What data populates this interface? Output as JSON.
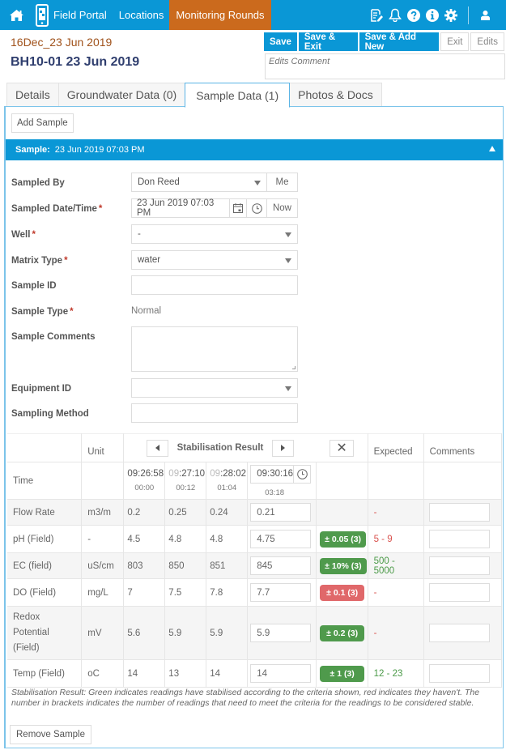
{
  "navbar": {
    "brand_label": "Field Portal",
    "links": [
      {
        "label": "Locations",
        "active": false
      },
      {
        "label": "Monitoring Rounds",
        "active": true
      }
    ],
    "right_icons": [
      "edit-notes-icon",
      "bell-icon",
      "help-icon",
      "info-icon",
      "gear-icon",
      "user-icon"
    ],
    "colors": {
      "bar": "#0a97d6",
      "active": "#cb6a1d"
    }
  },
  "header": {
    "round_title": "16Dec_23 Jun 2019",
    "record_title": "BH10-01 23 Jun 2019",
    "buttons": {
      "save": "Save",
      "save_exit": "Save & Exit",
      "save_add_new": "Save & Add New",
      "exit": "Exit",
      "edits": "Edits"
    },
    "edits_comment_placeholder": "Edits Comment"
  },
  "tabs": [
    {
      "label": "Details",
      "active": false
    },
    {
      "label": "Groundwater Data (0)",
      "active": false
    },
    {
      "label": "Sample Data (1)",
      "active": true
    },
    {
      "label": "Photos & Docs",
      "active": false
    }
  ],
  "sample_panel": {
    "add_sample_label": "Add Sample",
    "header_label": "Sample:",
    "header_value": "23 Jun 2019 07:03 PM",
    "form": {
      "sampled_by": {
        "label": "Sampled By",
        "value": "Don Reed",
        "me_label": "Me"
      },
      "sampled_datetime": {
        "label": "Sampled Date/Time",
        "required": "*",
        "value": "23 Jun 2019 07:03 PM",
        "now_label": "Now"
      },
      "well": {
        "label": "Well",
        "required": "*",
        "value": "-"
      },
      "matrix_type": {
        "label": "Matrix Type",
        "required": "*",
        "value": "water"
      },
      "sample_id": {
        "label": "Sample ID",
        "value": ""
      },
      "sample_type": {
        "label": "Sample Type",
        "required": "*",
        "value": "Normal"
      },
      "sample_comments": {
        "label": "Sample Comments",
        "value": ""
      },
      "equipment_id": {
        "label": "Equipment ID",
        "value": ""
      },
      "sampling_method": {
        "label": "Sampling Method",
        "value": ""
      }
    },
    "stabilisation": {
      "headers": {
        "unit": "Unit",
        "title": "Stabilisation Result",
        "expected": "Expected",
        "comments": "Comments"
      },
      "time_row": {
        "label": "Time",
        "readings": [
          {
            "prefix": "",
            "time": "09:26:58",
            "elapsed": "00:00"
          },
          {
            "prefix": "09",
            "time": ":27:10",
            "elapsed": "00:12"
          },
          {
            "prefix": "09",
            "time": ":28:02",
            "elapsed": "01:04"
          }
        ],
        "current": {
          "time": "09:30:16",
          "elapsed": "03:18"
        }
      },
      "rows": [
        {
          "param": "Flow Rate",
          "unit": "m3/m",
          "r1": "0.2",
          "r2": "0.25",
          "r3": "0.24",
          "current": "0.21",
          "badge": "",
          "badge_status": "none",
          "expected": "-",
          "expected_status": "dash"
        },
        {
          "param": "pH (Field)",
          "unit": "-",
          "r1": "4.5",
          "r2": "4.8",
          "r3": "4.8",
          "current": "4.75",
          "badge": "± 0.05 (3)",
          "badge_status": "green",
          "expected": "5 - 9",
          "expected_status": "red"
        },
        {
          "param": "EC (field)",
          "unit": "uS/cm",
          "r1": "803",
          "r2": "850",
          "r3": "851",
          "current": "845",
          "badge": "± 10% (3)",
          "badge_status": "green",
          "expected": "500 - 5000",
          "expected_status": "green"
        },
        {
          "param": "DO (Field)",
          "unit": "mg/L",
          "r1": "7",
          "r2": "7.5",
          "r3": "7.8",
          "current": "7.7",
          "badge": "± 0.1 (3)",
          "badge_status": "red",
          "expected": "-",
          "expected_status": "dash"
        },
        {
          "param": "Redox Potential (Field)",
          "unit": "mV",
          "r1": "5.6",
          "r2": "5.9",
          "r3": "5.9",
          "current": "5.9",
          "badge": "± 0.2 (3)",
          "badge_status": "green",
          "expected": "-",
          "expected_status": "dash"
        },
        {
          "param": "Temp (Field)",
          "unit": "oC",
          "r1": "14",
          "r2": "13",
          "r3": "14",
          "current": "14",
          "badge": "± 1 (3)",
          "badge_status": "green",
          "expected": "12 - 23",
          "expected_status": "green"
        }
      ],
      "colors": {
        "green": "#4f9a4c",
        "red": "#e0686a"
      }
    },
    "note": "Stabilisation Result: Green indicates readings have stabilised according to the criteria shown, red indicates they haven't. The number in brackets indicates the number of readings that need to meet the criteria for the readings to be considered stable.",
    "remove_sample_label": "Remove Sample"
  }
}
